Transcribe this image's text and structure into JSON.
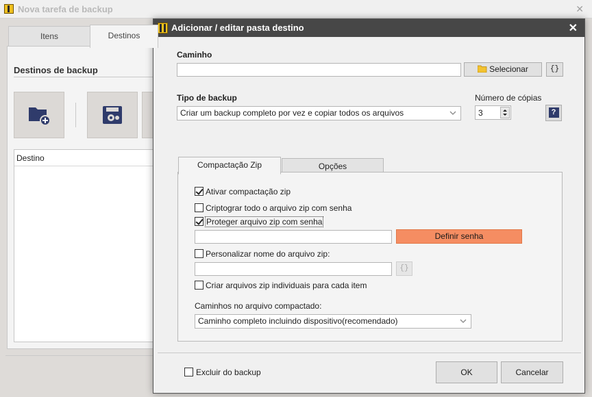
{
  "background_window": {
    "title": "Nova tarefa de backup",
    "close_glyph": "✕",
    "tabs": [
      {
        "label": "Itens",
        "active": false
      },
      {
        "label": "Destinos",
        "active": true
      }
    ],
    "section_title": "Destinos de backup",
    "tiles": [
      {
        "icon": "add-folder-icon"
      },
      {
        "icon": "disk-icon"
      }
    ],
    "list_header": "Destino"
  },
  "dialog": {
    "title": "Adicionar / editar pasta destino",
    "close_glyph": "✕",
    "path": {
      "label": "Caminho",
      "value": "",
      "select_label": "Selecionar",
      "select_icon": "folder-icon",
      "variables_label": "{}"
    },
    "backup_type": {
      "label": "Tipo de backup",
      "selected": "Criar um backup completo por vez e copiar todos os arquivos"
    },
    "copies": {
      "label": "Número de cópias",
      "value": "3",
      "help_label": "?"
    },
    "tabs": [
      {
        "label": "Compactação Zip",
        "active": true
      },
      {
        "label": "Opções",
        "active": false
      }
    ],
    "zip": {
      "enable": {
        "label": "Ativar compactação zip",
        "checked": true
      },
      "encrypt": {
        "label": "Criptograr todo o arquivo zip com senha",
        "checked": false
      },
      "protect": {
        "label": "Proteger arquivo zip com senha",
        "checked": true
      },
      "password_value": "",
      "set_password_label": "Definir senha",
      "set_password_color": "#f58d62",
      "custom_name": {
        "label": "Personalizar nome do arquivo zip:",
        "checked": false
      },
      "custom_name_value": "",
      "custom_name_vars_label": "{}",
      "individual": {
        "label": "Criar arquivos zip individuais para cada item",
        "checked": false
      },
      "paths_label": "Caminhos no arquivo compactado:",
      "paths_selected": "Caminho completo incluindo dispositivo(recomendado)"
    },
    "exclude": {
      "label": "Excluir do backup",
      "checked": false
    },
    "ok_label": "OK",
    "cancel_label": "Cancelar"
  }
}
